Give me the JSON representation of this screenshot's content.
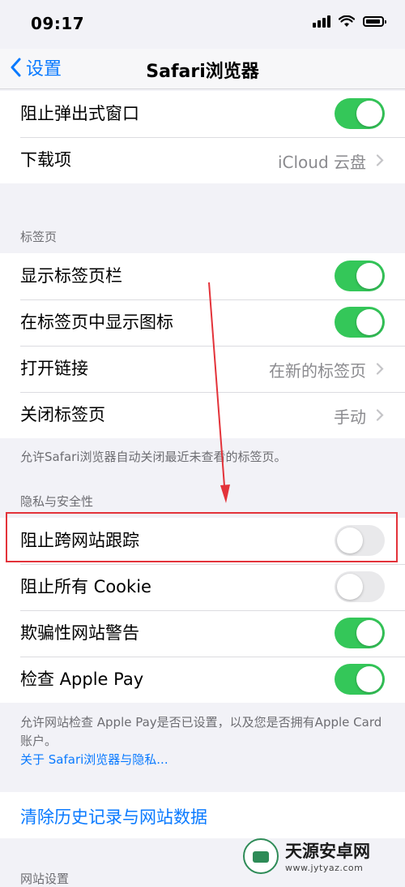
{
  "status_bar": {
    "time": "09:17"
  },
  "nav": {
    "back_label": "设置",
    "title": "Safari浏览器"
  },
  "general": {
    "rows": [
      {
        "label": "阻止弹出式窗口",
        "toggle": "on"
      },
      {
        "label": "下载项",
        "value": "iCloud 云盘"
      }
    ]
  },
  "tabs_section": {
    "header": "标签页",
    "rows": [
      {
        "label": "显示标签页栏",
        "toggle": "on"
      },
      {
        "label": "在标签页中显示图标",
        "toggle": "on"
      },
      {
        "label": "打开链接",
        "value": "在新的标签页"
      },
      {
        "label": "关闭标签页",
        "value": "手动"
      }
    ],
    "footer": "允许Safari浏览器自动关闭最近未查看的标签页。"
  },
  "privacy_section": {
    "header": "隐私与安全性",
    "rows": [
      {
        "label": "阻止跨网站跟踪",
        "toggle": "off"
      },
      {
        "label": "阻止所有 Cookie",
        "toggle": "off"
      },
      {
        "label": "欺骗性网站警告",
        "toggle": "on"
      },
      {
        "label": "检查 Apple Pay",
        "toggle": "on"
      }
    ],
    "footer": "允许网站检查 Apple Pay是否已设置，以及您是否拥有Apple Card账户。",
    "footer_link": "关于 Safari浏览器与隐私..."
  },
  "clear_history": {
    "label": "清除历史记录与网站数据"
  },
  "website_settings": {
    "header": "网站设置"
  },
  "watermark": {
    "title": "天源安卓网",
    "url": "www.jytyaz.com"
  },
  "colors": {
    "accent": "#0a7aff",
    "toggle_on": "#34c759",
    "highlight": "#e3333a"
  }
}
